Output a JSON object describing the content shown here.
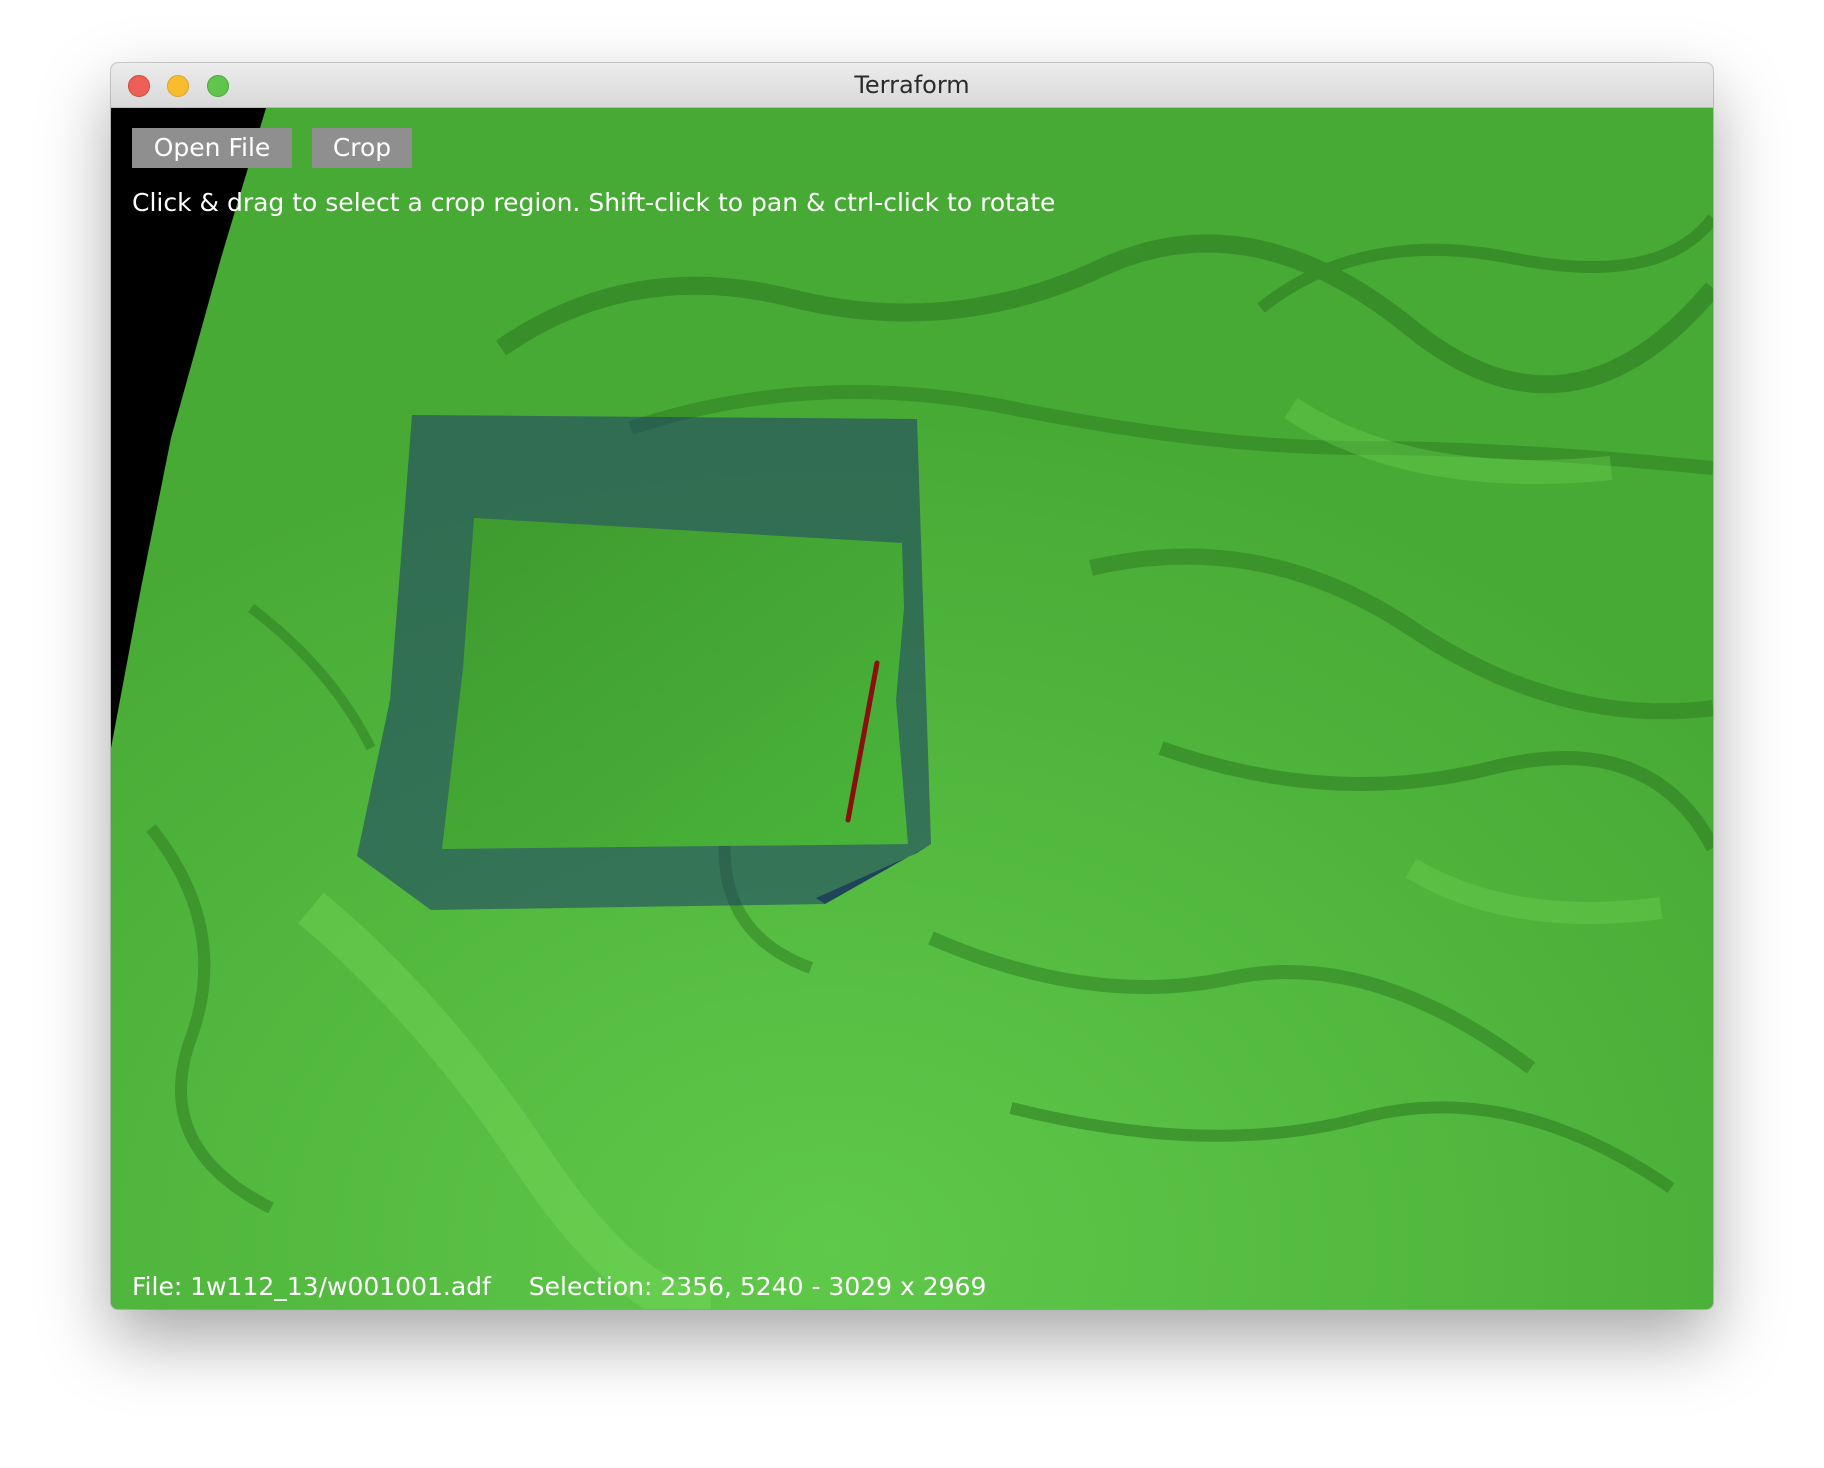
{
  "window": {
    "title": "Terraform"
  },
  "toolbar": {
    "open_file_label": "Open File",
    "crop_label": "Crop"
  },
  "hint": "Click & drag to select a crop region. Shift-click to pan & ctrl-click to rotate",
  "status": {
    "file": "File: 1w112_13/w001001.adf",
    "selection": "Selection: 2356, 5240 - 3029 x 2969"
  },
  "colors": {
    "terrain": "#4fb83a",
    "terrain_shadow": "#2f7a22",
    "selection_box": "#1f3a66",
    "marker": "#8a1010",
    "void": "#000000"
  },
  "icons": {
    "close": "close-icon",
    "minimize": "minimize-icon",
    "maximize": "maximize-icon"
  }
}
